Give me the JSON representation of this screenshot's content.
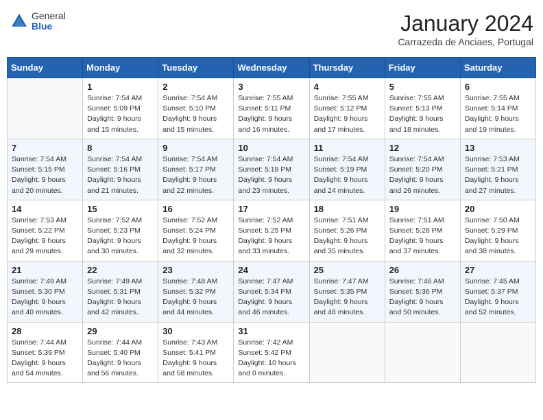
{
  "header": {
    "logo_general": "General",
    "logo_blue": "Blue",
    "month_title": "January 2024",
    "subtitle": "Carrazeda de Anciaes, Portugal"
  },
  "days_of_week": [
    "Sunday",
    "Monday",
    "Tuesday",
    "Wednesday",
    "Thursday",
    "Friday",
    "Saturday"
  ],
  "weeks": [
    [
      {
        "day": "",
        "sunrise": "",
        "sunset": "",
        "daylight": ""
      },
      {
        "day": "1",
        "sunrise": "Sunrise: 7:54 AM",
        "sunset": "Sunset: 5:09 PM",
        "daylight": "Daylight: 9 hours and 15 minutes."
      },
      {
        "day": "2",
        "sunrise": "Sunrise: 7:54 AM",
        "sunset": "Sunset: 5:10 PM",
        "daylight": "Daylight: 9 hours and 15 minutes."
      },
      {
        "day": "3",
        "sunrise": "Sunrise: 7:55 AM",
        "sunset": "Sunset: 5:11 PM",
        "daylight": "Daylight: 9 hours and 16 minutes."
      },
      {
        "day": "4",
        "sunrise": "Sunrise: 7:55 AM",
        "sunset": "Sunset: 5:12 PM",
        "daylight": "Daylight: 9 hours and 17 minutes."
      },
      {
        "day": "5",
        "sunrise": "Sunrise: 7:55 AM",
        "sunset": "Sunset: 5:13 PM",
        "daylight": "Daylight: 9 hours and 18 minutes."
      },
      {
        "day": "6",
        "sunrise": "Sunrise: 7:55 AM",
        "sunset": "Sunset: 5:14 PM",
        "daylight": "Daylight: 9 hours and 19 minutes."
      }
    ],
    [
      {
        "day": "7",
        "sunrise": "Sunrise: 7:54 AM",
        "sunset": "Sunset: 5:15 PM",
        "daylight": "Daylight: 9 hours and 20 minutes."
      },
      {
        "day": "8",
        "sunrise": "Sunrise: 7:54 AM",
        "sunset": "Sunset: 5:16 PM",
        "daylight": "Daylight: 9 hours and 21 minutes."
      },
      {
        "day": "9",
        "sunrise": "Sunrise: 7:54 AM",
        "sunset": "Sunset: 5:17 PM",
        "daylight": "Daylight: 9 hours and 22 minutes."
      },
      {
        "day": "10",
        "sunrise": "Sunrise: 7:54 AM",
        "sunset": "Sunset: 5:18 PM",
        "daylight": "Daylight: 9 hours and 23 minutes."
      },
      {
        "day": "11",
        "sunrise": "Sunrise: 7:54 AM",
        "sunset": "Sunset: 5:19 PM",
        "daylight": "Daylight: 9 hours and 24 minutes."
      },
      {
        "day": "12",
        "sunrise": "Sunrise: 7:54 AM",
        "sunset": "Sunset: 5:20 PM",
        "daylight": "Daylight: 9 hours and 26 minutes."
      },
      {
        "day": "13",
        "sunrise": "Sunrise: 7:53 AM",
        "sunset": "Sunset: 5:21 PM",
        "daylight": "Daylight: 9 hours and 27 minutes."
      }
    ],
    [
      {
        "day": "14",
        "sunrise": "Sunrise: 7:53 AM",
        "sunset": "Sunset: 5:22 PM",
        "daylight": "Daylight: 9 hours and 29 minutes."
      },
      {
        "day": "15",
        "sunrise": "Sunrise: 7:52 AM",
        "sunset": "Sunset: 5:23 PM",
        "daylight": "Daylight: 9 hours and 30 minutes."
      },
      {
        "day": "16",
        "sunrise": "Sunrise: 7:52 AM",
        "sunset": "Sunset: 5:24 PM",
        "daylight": "Daylight: 9 hours and 32 minutes."
      },
      {
        "day": "17",
        "sunrise": "Sunrise: 7:52 AM",
        "sunset": "Sunset: 5:25 PM",
        "daylight": "Daylight: 9 hours and 33 minutes."
      },
      {
        "day": "18",
        "sunrise": "Sunrise: 7:51 AM",
        "sunset": "Sunset: 5:26 PM",
        "daylight": "Daylight: 9 hours and 35 minutes."
      },
      {
        "day": "19",
        "sunrise": "Sunrise: 7:51 AM",
        "sunset": "Sunset: 5:28 PM",
        "daylight": "Daylight: 9 hours and 37 minutes."
      },
      {
        "day": "20",
        "sunrise": "Sunrise: 7:50 AM",
        "sunset": "Sunset: 5:29 PM",
        "daylight": "Daylight: 9 hours and 38 minutes."
      }
    ],
    [
      {
        "day": "21",
        "sunrise": "Sunrise: 7:49 AM",
        "sunset": "Sunset: 5:30 PM",
        "daylight": "Daylight: 9 hours and 40 minutes."
      },
      {
        "day": "22",
        "sunrise": "Sunrise: 7:49 AM",
        "sunset": "Sunset: 5:31 PM",
        "daylight": "Daylight: 9 hours and 42 minutes."
      },
      {
        "day": "23",
        "sunrise": "Sunrise: 7:48 AM",
        "sunset": "Sunset: 5:32 PM",
        "daylight": "Daylight: 9 hours and 44 minutes."
      },
      {
        "day": "24",
        "sunrise": "Sunrise: 7:47 AM",
        "sunset": "Sunset: 5:34 PM",
        "daylight": "Daylight: 9 hours and 46 minutes."
      },
      {
        "day": "25",
        "sunrise": "Sunrise: 7:47 AM",
        "sunset": "Sunset: 5:35 PM",
        "daylight": "Daylight: 9 hours and 48 minutes."
      },
      {
        "day": "26",
        "sunrise": "Sunrise: 7:46 AM",
        "sunset": "Sunset: 5:36 PM",
        "daylight": "Daylight: 9 hours and 50 minutes."
      },
      {
        "day": "27",
        "sunrise": "Sunrise: 7:45 AM",
        "sunset": "Sunset: 5:37 PM",
        "daylight": "Daylight: 9 hours and 52 minutes."
      }
    ],
    [
      {
        "day": "28",
        "sunrise": "Sunrise: 7:44 AM",
        "sunset": "Sunset: 5:39 PM",
        "daylight": "Daylight: 9 hours and 54 minutes."
      },
      {
        "day": "29",
        "sunrise": "Sunrise: 7:44 AM",
        "sunset": "Sunset: 5:40 PM",
        "daylight": "Daylight: 9 hours and 56 minutes."
      },
      {
        "day": "30",
        "sunrise": "Sunrise: 7:43 AM",
        "sunset": "Sunset: 5:41 PM",
        "daylight": "Daylight: 9 hours and 58 minutes."
      },
      {
        "day": "31",
        "sunrise": "Sunrise: 7:42 AM",
        "sunset": "Sunset: 5:42 PM",
        "daylight": "Daylight: 10 hours and 0 minutes."
      },
      {
        "day": "",
        "sunrise": "",
        "sunset": "",
        "daylight": ""
      },
      {
        "day": "",
        "sunrise": "",
        "sunset": "",
        "daylight": ""
      },
      {
        "day": "",
        "sunrise": "",
        "sunset": "",
        "daylight": ""
      }
    ]
  ]
}
